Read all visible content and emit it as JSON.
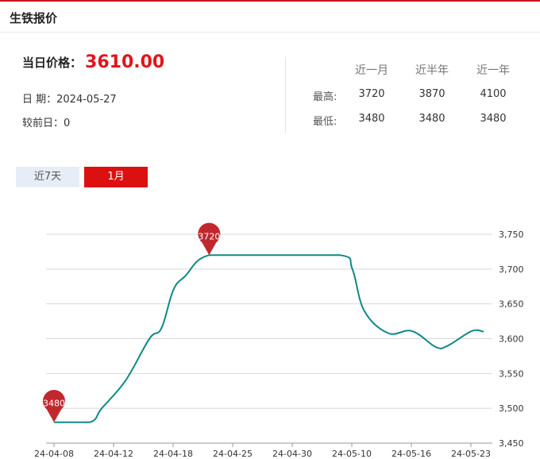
{
  "header": {
    "title": "生铁报价"
  },
  "summary": {
    "price_label": "当日价格：",
    "price_value": "3610.00",
    "date_label": "日 期：",
    "date_value": "2024-05-27",
    "change_label": "较前日：",
    "change_value": "0"
  },
  "stats": {
    "columns": [
      "近一月",
      "近半年",
      "近一年"
    ],
    "rows": [
      {
        "label": "最高:",
        "values": [
          "3720",
          "3870",
          "4100"
        ]
      },
      {
        "label": "最低:",
        "values": [
          "3480",
          "3480",
          "3480"
        ]
      }
    ]
  },
  "tabs": [
    {
      "label": "近7天",
      "active": false
    },
    {
      "label": "1月",
      "active": true
    }
  ],
  "colors": {
    "accent": "#e4141b",
    "line": "#0e8a86",
    "marker": "#c0282e",
    "grid": "#d8d8d8"
  },
  "chart_data": {
    "type": "line",
    "title": "",
    "xlabel": "",
    "ylabel": "",
    "ylim": [
      3450,
      3750
    ],
    "yticks": [
      3450,
      3500,
      3550,
      3600,
      3650,
      3700,
      3750
    ],
    "ytick_labels": [
      "3,450",
      "3,500",
      "3,550",
      "3,600",
      "3,650",
      "3,700",
      "3,750"
    ],
    "xtick_labels": [
      "24-04-08",
      "24-04-12",
      "24-04-18",
      "24-04-25",
      "24-04-30",
      "24-05-10",
      "24-05-16",
      "24-05-23"
    ],
    "grid": true,
    "series": [
      {
        "name": "",
        "points": [
          [
            0,
            3480
          ],
          [
            3,
            3480
          ],
          [
            4,
            3500
          ],
          [
            6,
            3540
          ],
          [
            8,
            3600
          ],
          [
            9,
            3615
          ],
          [
            10,
            3670
          ],
          [
            11,
            3690
          ],
          [
            13,
            3720
          ],
          [
            18,
            3720
          ],
          [
            24,
            3720
          ],
          [
            25,
            3700
          ],
          [
            26,
            3640
          ],
          [
            28,
            3608
          ],
          [
            30,
            3611
          ],
          [
            32,
            3588
          ],
          [
            33,
            3590
          ],
          [
            35,
            3611
          ],
          [
            36,
            3610
          ]
        ]
      }
    ],
    "annotations": [
      {
        "label": "3480",
        "point": [
          0,
          3480
        ],
        "kind": "min"
      },
      {
        "label": "3720",
        "point": [
          13,
          3720
        ],
        "kind": "max"
      }
    ]
  }
}
